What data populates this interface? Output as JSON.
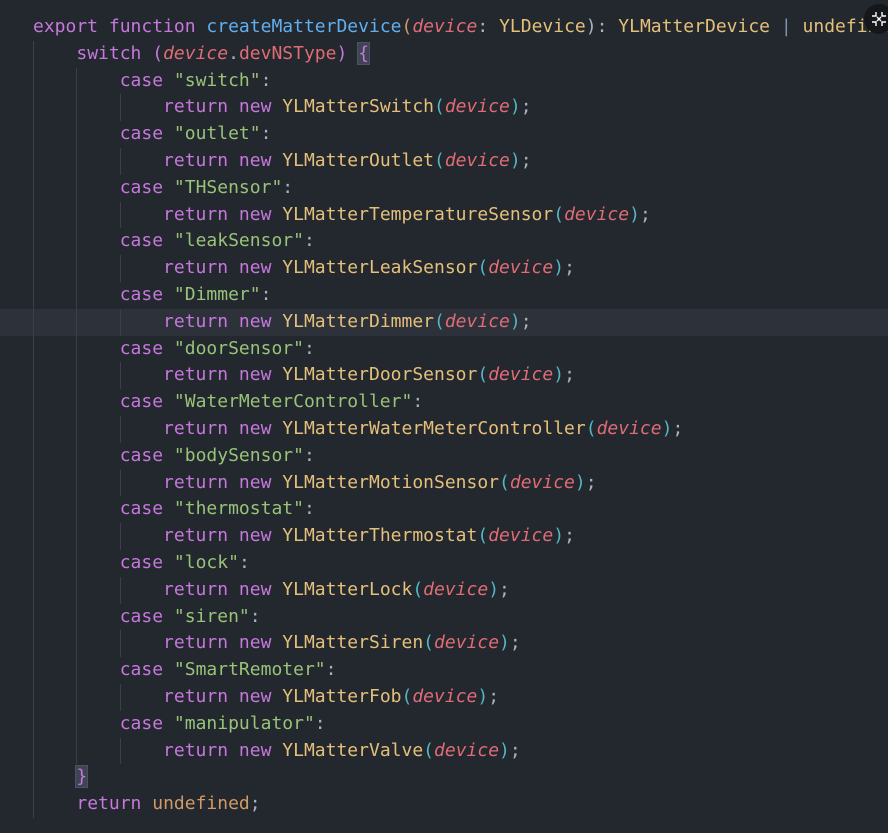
{
  "editor": {
    "current_line": 11,
    "lines": [
      {
        "indent": 0,
        "tokens": [
          [
            "export",
            "kw"
          ],
          [
            " ",
            ""
          ],
          [
            "function",
            "kw"
          ],
          [
            " ",
            ""
          ],
          [
            "createMatterDevice",
            "fn"
          ],
          [
            "(",
            "b1"
          ],
          [
            "device",
            "param"
          ],
          [
            ": ",
            "punct"
          ],
          [
            "YLDevice",
            "type"
          ],
          [
            "): ",
            "punct"
          ],
          [
            "YLMatterDevice",
            "type"
          ],
          [
            " ",
            ""
          ],
          [
            "|",
            "op"
          ],
          [
            " ",
            ""
          ],
          [
            "undefined",
            "type"
          ]
        ]
      },
      {
        "indent": 1,
        "tokens": [
          [
            "switch",
            "kw"
          ],
          [
            " ",
            ""
          ],
          [
            "(",
            "b2"
          ],
          [
            "device",
            "param"
          ],
          [
            ".",
            "punct"
          ],
          [
            "devNSType",
            "prop"
          ],
          [
            ")",
            "b2"
          ],
          [
            " ",
            ""
          ],
          [
            "{",
            "b2 match"
          ]
        ]
      },
      {
        "indent": 2,
        "tokens": [
          [
            "case",
            "kw"
          ],
          [
            " ",
            ""
          ],
          [
            "\"switch\"",
            "str"
          ],
          [
            ":",
            "punct"
          ]
        ]
      },
      {
        "indent": 3,
        "tokens": [
          [
            "return",
            "kw"
          ],
          [
            " ",
            ""
          ],
          [
            "new",
            "kw"
          ],
          [
            " ",
            ""
          ],
          [
            "YLMatterSwitch",
            "class"
          ],
          [
            "(",
            "b3"
          ],
          [
            "device",
            "param"
          ],
          [
            ")",
            "b3"
          ],
          [
            ";",
            "punct"
          ]
        ]
      },
      {
        "indent": 2,
        "tokens": [
          [
            "case",
            "kw"
          ],
          [
            " ",
            ""
          ],
          [
            "\"outlet\"",
            "str"
          ],
          [
            ":",
            "punct"
          ]
        ]
      },
      {
        "indent": 3,
        "tokens": [
          [
            "return",
            "kw"
          ],
          [
            " ",
            ""
          ],
          [
            "new",
            "kw"
          ],
          [
            " ",
            ""
          ],
          [
            "YLMatterOutlet",
            "class"
          ],
          [
            "(",
            "b3"
          ],
          [
            "device",
            "param"
          ],
          [
            ")",
            "b3"
          ],
          [
            ";",
            "punct"
          ]
        ]
      },
      {
        "indent": 2,
        "tokens": [
          [
            "case",
            "kw"
          ],
          [
            " ",
            ""
          ],
          [
            "\"THSensor\"",
            "str"
          ],
          [
            ":",
            "punct"
          ]
        ]
      },
      {
        "indent": 3,
        "tokens": [
          [
            "return",
            "kw"
          ],
          [
            " ",
            ""
          ],
          [
            "new",
            "kw"
          ],
          [
            " ",
            ""
          ],
          [
            "YLMatterTemperatureSensor",
            "class"
          ],
          [
            "(",
            "b3"
          ],
          [
            "device",
            "param"
          ],
          [
            ")",
            "b3"
          ],
          [
            ";",
            "punct"
          ]
        ]
      },
      {
        "indent": 2,
        "tokens": [
          [
            "case",
            "kw"
          ],
          [
            " ",
            ""
          ],
          [
            "\"leakSensor\"",
            "str"
          ],
          [
            ":",
            "punct"
          ]
        ]
      },
      {
        "indent": 3,
        "tokens": [
          [
            "return",
            "kw"
          ],
          [
            " ",
            ""
          ],
          [
            "new",
            "kw"
          ],
          [
            " ",
            ""
          ],
          [
            "YLMatterLeakSensor",
            "class"
          ],
          [
            "(",
            "b3"
          ],
          [
            "device",
            "param"
          ],
          [
            ")",
            "b3"
          ],
          [
            ";",
            "punct"
          ]
        ]
      },
      {
        "indent": 2,
        "tokens": [
          [
            "case",
            "kw"
          ],
          [
            " ",
            ""
          ],
          [
            "\"Dimmer\"",
            "str"
          ],
          [
            ":",
            "punct"
          ]
        ]
      },
      {
        "indent": 3,
        "tokens": [
          [
            "return",
            "kw"
          ],
          [
            " ",
            ""
          ],
          [
            "new",
            "kw"
          ],
          [
            " ",
            ""
          ],
          [
            "YLMatterDimmer",
            "class"
          ],
          [
            "(",
            "b3"
          ],
          [
            "device",
            "param"
          ],
          [
            ")",
            "b3"
          ],
          [
            ";",
            "punct"
          ]
        ]
      },
      {
        "indent": 2,
        "tokens": [
          [
            "case",
            "kw"
          ],
          [
            " ",
            ""
          ],
          [
            "\"doorSensor\"",
            "str"
          ],
          [
            ":",
            "punct"
          ]
        ]
      },
      {
        "indent": 3,
        "tokens": [
          [
            "return",
            "kw"
          ],
          [
            " ",
            ""
          ],
          [
            "new",
            "kw"
          ],
          [
            " ",
            ""
          ],
          [
            "YLMatterDoorSensor",
            "class"
          ],
          [
            "(",
            "b3"
          ],
          [
            "device",
            "param"
          ],
          [
            ")",
            "b3"
          ],
          [
            ";",
            "punct"
          ]
        ]
      },
      {
        "indent": 2,
        "tokens": [
          [
            "case",
            "kw"
          ],
          [
            " ",
            ""
          ],
          [
            "\"WaterMeterController\"",
            "str"
          ],
          [
            ":",
            "punct"
          ]
        ]
      },
      {
        "indent": 3,
        "tokens": [
          [
            "return",
            "kw"
          ],
          [
            " ",
            ""
          ],
          [
            "new",
            "kw"
          ],
          [
            " ",
            ""
          ],
          [
            "YLMatterWaterMeterController",
            "class"
          ],
          [
            "(",
            "b3"
          ],
          [
            "device",
            "param"
          ],
          [
            ")",
            "b3"
          ],
          [
            ";",
            "punct"
          ]
        ]
      },
      {
        "indent": 2,
        "tokens": [
          [
            "case",
            "kw"
          ],
          [
            " ",
            ""
          ],
          [
            "\"bodySensor\"",
            "str"
          ],
          [
            ":",
            "punct"
          ]
        ]
      },
      {
        "indent": 3,
        "tokens": [
          [
            "return",
            "kw"
          ],
          [
            " ",
            ""
          ],
          [
            "new",
            "kw"
          ],
          [
            " ",
            ""
          ],
          [
            "YLMatterMotionSensor",
            "class"
          ],
          [
            "(",
            "b3"
          ],
          [
            "device",
            "param"
          ],
          [
            ")",
            "b3"
          ],
          [
            ";",
            "punct"
          ]
        ]
      },
      {
        "indent": 2,
        "tokens": [
          [
            "case",
            "kw"
          ],
          [
            " ",
            ""
          ],
          [
            "\"thermostat\"",
            "str"
          ],
          [
            ":",
            "punct"
          ]
        ]
      },
      {
        "indent": 3,
        "tokens": [
          [
            "return",
            "kw"
          ],
          [
            " ",
            ""
          ],
          [
            "new",
            "kw"
          ],
          [
            " ",
            ""
          ],
          [
            "YLMatterThermostat",
            "class"
          ],
          [
            "(",
            "b3"
          ],
          [
            "device",
            "param"
          ],
          [
            ")",
            "b3"
          ],
          [
            ";",
            "punct"
          ]
        ]
      },
      {
        "indent": 2,
        "tokens": [
          [
            "case",
            "kw"
          ],
          [
            " ",
            ""
          ],
          [
            "\"lock\"",
            "str"
          ],
          [
            ":",
            "punct"
          ]
        ]
      },
      {
        "indent": 3,
        "tokens": [
          [
            "return",
            "kw"
          ],
          [
            " ",
            ""
          ],
          [
            "new",
            "kw"
          ],
          [
            " ",
            ""
          ],
          [
            "YLMatterLock",
            "class"
          ],
          [
            "(",
            "b3"
          ],
          [
            "device",
            "param"
          ],
          [
            ")",
            "b3"
          ],
          [
            ";",
            "punct"
          ]
        ]
      },
      {
        "indent": 2,
        "tokens": [
          [
            "case",
            "kw"
          ],
          [
            " ",
            ""
          ],
          [
            "\"siren\"",
            "str"
          ],
          [
            ":",
            "punct"
          ]
        ]
      },
      {
        "indent": 3,
        "tokens": [
          [
            "return",
            "kw"
          ],
          [
            " ",
            ""
          ],
          [
            "new",
            "kw"
          ],
          [
            " ",
            ""
          ],
          [
            "YLMatterSiren",
            "class"
          ],
          [
            "(",
            "b3"
          ],
          [
            "device",
            "param"
          ],
          [
            ")",
            "b3"
          ],
          [
            ";",
            "punct"
          ]
        ]
      },
      {
        "indent": 2,
        "tokens": [
          [
            "case",
            "kw"
          ],
          [
            " ",
            ""
          ],
          [
            "\"SmartRemoter\"",
            "str"
          ],
          [
            ":",
            "punct"
          ]
        ]
      },
      {
        "indent": 3,
        "tokens": [
          [
            "return",
            "kw"
          ],
          [
            " ",
            ""
          ],
          [
            "new",
            "kw"
          ],
          [
            " ",
            ""
          ],
          [
            "YLMatterFob",
            "class"
          ],
          [
            "(",
            "b3"
          ],
          [
            "device",
            "param"
          ],
          [
            ")",
            "b3"
          ],
          [
            ";",
            "punct"
          ]
        ]
      },
      {
        "indent": 2,
        "tokens": [
          [
            "case",
            "kw"
          ],
          [
            " ",
            ""
          ],
          [
            "\"manipulator\"",
            "str"
          ],
          [
            ":",
            "punct"
          ]
        ]
      },
      {
        "indent": 3,
        "tokens": [
          [
            "return",
            "kw"
          ],
          [
            " ",
            ""
          ],
          [
            "new",
            "kw"
          ],
          [
            " ",
            ""
          ],
          [
            "YLMatterValve",
            "class"
          ],
          [
            "(",
            "b3"
          ],
          [
            "device",
            "param"
          ],
          [
            ")",
            "b3"
          ],
          [
            ";",
            "punct"
          ]
        ]
      },
      {
        "indent": 1,
        "tokens": [
          [
            "}",
            "b2 match"
          ]
        ]
      },
      {
        "indent": 1,
        "tokens": [
          [
            "return",
            "kw"
          ],
          [
            " ",
            ""
          ],
          [
            "undefined",
            "const"
          ],
          [
            ";",
            "punct"
          ]
        ]
      }
    ]
  },
  "close_button": {
    "icon": "fullscreen-exit-icon"
  }
}
